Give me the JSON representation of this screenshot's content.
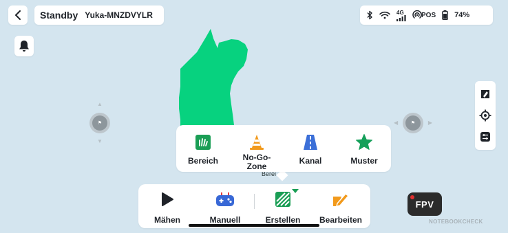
{
  "header": {
    "status": "Standby",
    "device_name": "Yuka-MNZDVYLR"
  },
  "status_bar": {
    "network": "4G",
    "pos_label": "POS",
    "battery": "74%",
    "icons": [
      "bluetooth-icon",
      "wifi-icon",
      "cellular-4g-icon",
      "rtk-pos-icon",
      "battery-icon"
    ]
  },
  "map": {
    "zone_color": "#07d27f",
    "under_popup_label": "Berei"
  },
  "create_popup": {
    "items": [
      {
        "label": "Bereich",
        "icon": "grass-area-icon",
        "color": "#1a9e55"
      },
      {
        "label": "No-Go-\nZone",
        "icon": "traffic-cone-icon",
        "color": "#f29a1c"
      },
      {
        "label": "Kanal",
        "icon": "road-channel-icon",
        "color": "#3b6fd8"
      },
      {
        "label": "Muster",
        "icon": "star-icon",
        "color": "#15a05a"
      }
    ]
  },
  "bottom_bar": {
    "items": [
      {
        "label": "Mähen",
        "icon": "play-icon"
      },
      {
        "label": "Manuell",
        "icon": "gamepad-icon"
      },
      {
        "label": "Erstellen",
        "icon": "create-icon"
      },
      {
        "label": "Bearbeiten",
        "icon": "edit-icon"
      }
    ]
  },
  "fpv": {
    "label": "FPV"
  },
  "watermark": "NOTEBOOKCHECK"
}
